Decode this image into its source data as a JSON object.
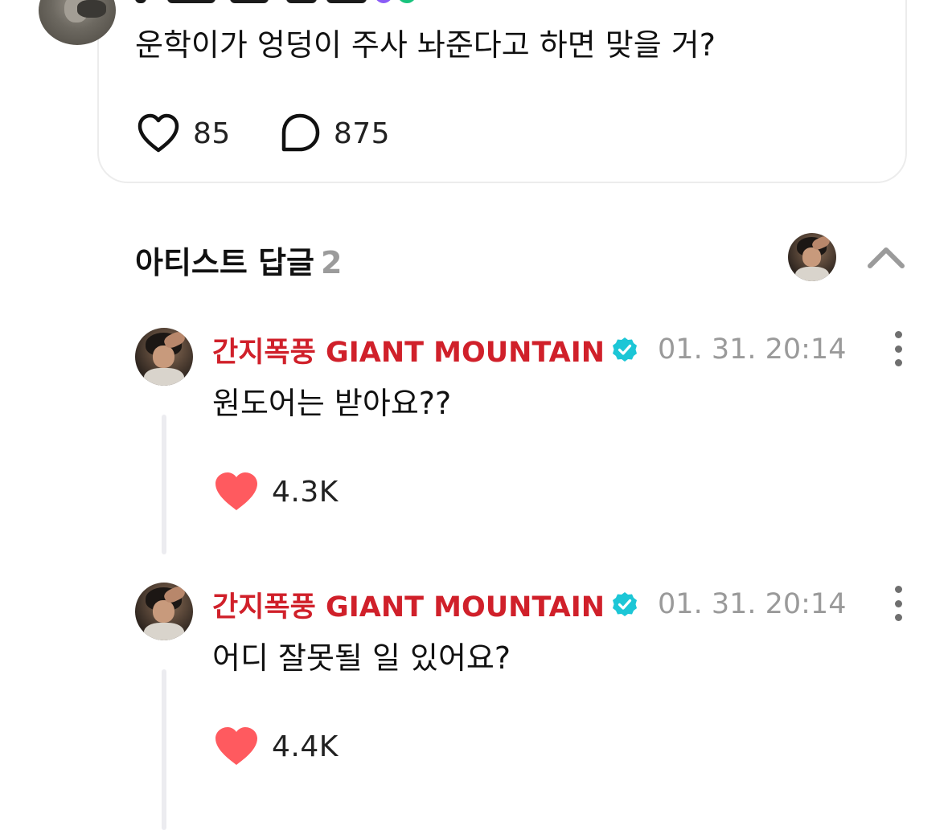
{
  "post": {
    "text": "운학이가 엉덩이 주사 놔준다고 하면 맞을 거?",
    "likes": "85",
    "comments": "875"
  },
  "replies_section": {
    "title": "아티스트 답글",
    "count": "2"
  },
  "replies": [
    {
      "author": "간지폭풍 GIANT MOUNTAIN",
      "time": "01. 31. 20:14",
      "text": "원도어는 받아요??",
      "likes": "4.3K"
    },
    {
      "author": "간지폭풍 GIANT MOUNTAIN",
      "time": "01. 31. 20:14",
      "text": "어디 잘못될 일 있어요?",
      "likes": "4.4K"
    }
  ],
  "colors": {
    "author": "#d0202a",
    "verified": "#1cc6d6",
    "liked_heart": "#ff5a5f",
    "muted": "#9a9a9a"
  },
  "icons": {
    "like": "heart-outline-icon",
    "comment": "speech-bubble-icon",
    "collapse": "chevron-up-icon",
    "verified": "verified-badge-icon",
    "more": "more-vertical-icon",
    "liked": "heart-filled-icon"
  }
}
